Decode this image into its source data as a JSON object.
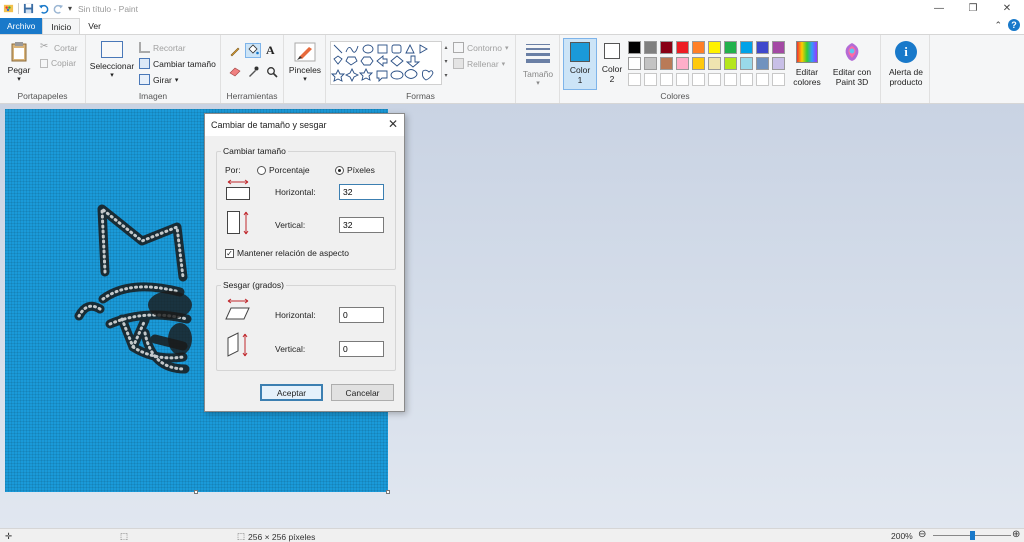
{
  "window": {
    "title": "Sin título - Paint"
  },
  "tabs": {
    "file": "Archivo",
    "home": "Inicio",
    "view": "Ver"
  },
  "ribbon": {
    "clipboard": {
      "label": "Portapapeles",
      "paste": "Pegar",
      "cut": "Cortar",
      "copy": "Copiar"
    },
    "image": {
      "label": "Imagen",
      "select": "Seleccionar",
      "crop": "Recortar",
      "resize": "Cambiar tamaño",
      "rotate": "Girar"
    },
    "tools": {
      "label": "Herramientas"
    },
    "brushes": {
      "label": "Pinceles"
    },
    "shapes": {
      "label": "Formas",
      "outline": "Contorno",
      "fill": "Rellenar"
    },
    "size": {
      "label": "Tamaño"
    },
    "colors": {
      "label": "Colores",
      "color1": "Color\n1",
      "color1_a": "Color",
      "color1_b": "1",
      "color2_a": "Color",
      "color2_b": "2",
      "edit_colors_a": "Editar",
      "edit_colors_b": "colores",
      "paint3d_a": "Editar con",
      "paint3d_b": "Paint 3D",
      "alert_a": "Alerta de",
      "alert_b": "producto",
      "color1_value": "#1a9ad9",
      "color2_value": "#ffffff",
      "palette": [
        "#000000",
        "#7f7f7f",
        "#880015",
        "#ed1c24",
        "#ff7f27",
        "#fff200",
        "#22b14c",
        "#00a2e8",
        "#3f48cc",
        "#a349a4",
        "#ffffff",
        "#c3c3c3",
        "#b97a57",
        "#ffaec9",
        "#ffc90e",
        "#efe4b0",
        "#b5e61d",
        "#99d9ea",
        "#7092be",
        "#c8bfe7"
      ]
    }
  },
  "dialog": {
    "title": "Cambiar de tamaño y sesgar",
    "resize_section": "Cambiar tamaño",
    "by_label": "Por:",
    "percent_label": "Porcentaje",
    "pixels_label": "Píxeles",
    "horizontal_label": "Horizontal:",
    "horizontal_value": "32",
    "vertical_label": "Vertical:",
    "vertical_value": "32",
    "maintain_aspect": "Mantener relación de aspecto",
    "skew_section": "Sesgar (grados)",
    "skew_horizontal_label": "Horizontal:",
    "skew_horizontal_value": "0",
    "skew_vertical_label": "Vertical:",
    "skew_vertical_value": "0",
    "ok": "Aceptar",
    "cancel": "Cancelar"
  },
  "statusbar": {
    "image_size": "256 × 256 píxeles",
    "zoom": "200%"
  }
}
